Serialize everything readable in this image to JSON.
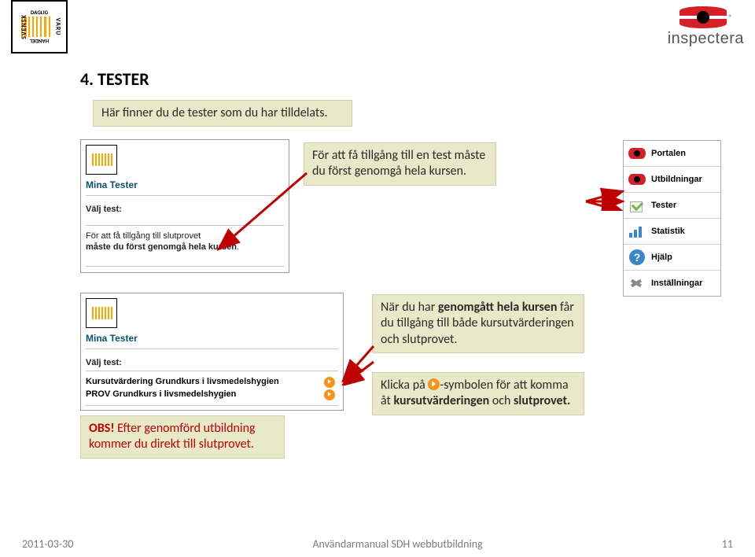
{
  "logo_sdh": {
    "line1": "DAGLIG",
    "line2": "HANDEL",
    "side_left": "SVENSK",
    "side_right": "VARU"
  },
  "logo_inspectera": {
    "text": "inspectera",
    "registered": "®"
  },
  "heading": "4.   TESTER",
  "callout1": "Här finner du de tester som du har tilldelats.",
  "callout2": "För att få tillgång till en test måste du först genomgå hela kursen.",
  "callout3_prefix": "När du har ",
  "callout3_bold": "genomgått hela kursen",
  "callout3_suffix": " får du tillgång till både kursutvärderingen och slutprovet.",
  "callout4_a": "Klicka på ",
  "callout4_b": "-symbolen för att komma åt ",
  "callout4_c": "kursutvärderingen",
  "callout4_d": " och ",
  "callout4_e": "slutprovet.",
  "callout5_a": "OBS!",
  "callout5_b": " Efter genomförd utbildning kommer du direkt till slutprovet.",
  "shot": {
    "mina_tester": "Mina Tester",
    "valj": "Välj test:",
    "info_line1": "För att få tillgång till slutprovet",
    "info_line2a": "måste du först genomgå hela kursen",
    "info_line2b": ".",
    "row1": "Kursutvärdering Grundkurs i livsmedelshygien",
    "row2": "PROV Grundkurs i livsmedelshygien"
  },
  "nav": {
    "items": [
      {
        "label": "Portalen"
      },
      {
        "label": "Utbildningar"
      },
      {
        "label": "Tester"
      },
      {
        "label": "Statistik"
      },
      {
        "label": "Hjälp"
      },
      {
        "label": "Inställningar"
      }
    ]
  },
  "footer": {
    "date": "2011-03-30",
    "title": "Användarmanual SDH webbutbildning",
    "page": "11"
  }
}
